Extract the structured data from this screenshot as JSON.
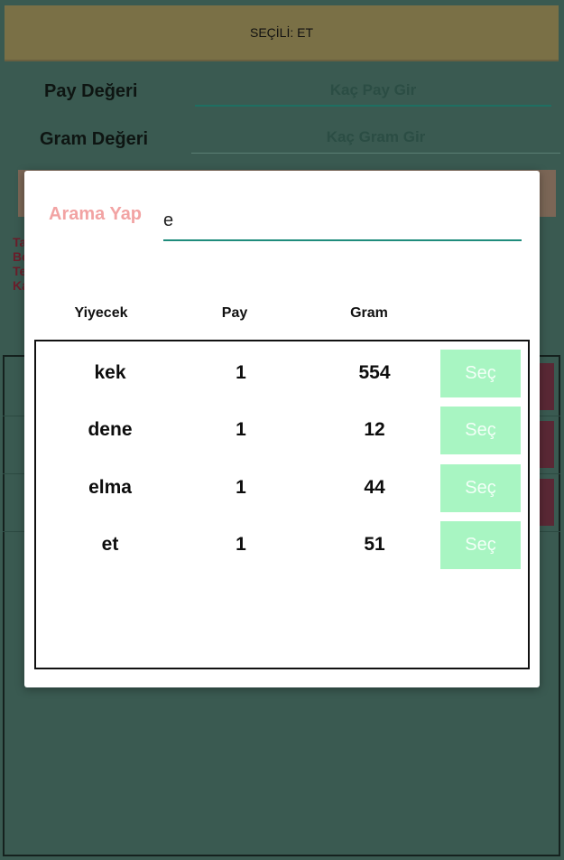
{
  "banner": {
    "selected_text": "SEÇİLİ: ET"
  },
  "form": {
    "pay_label": "Pay Değeri",
    "pay_placeholder": "Kaç Pay Gir",
    "gram_label": "Gram Değeri",
    "gram_placeholder": "Kaç Gram Gir"
  },
  "background_info": {
    "lines": [
      "Ta",
      "Bo",
      "Te",
      "Ka"
    ]
  },
  "dialog": {
    "search_label": "Arama Yap",
    "search_value": "e",
    "columns": [
      "Yiyecek",
      "Pay",
      "Gram"
    ],
    "rows": [
      {
        "food": "kek",
        "pay": "1",
        "gram": "554",
        "button": "Seç"
      },
      {
        "food": "dene",
        "pay": "1",
        "gram": "12",
        "button": "Seç"
      },
      {
        "food": "elma",
        "pay": "1",
        "gram": "44",
        "button": "Seç"
      },
      {
        "food": "et",
        "pay": "1",
        "gram": "51",
        "button": "Seç"
      }
    ]
  },
  "colors": {
    "background_dim": "#3a5a51",
    "banner": "#7a7046",
    "accent_teal": "#1f8c7c",
    "search_label": "#f2a3a3",
    "select_button": "#a8f5c2"
  }
}
